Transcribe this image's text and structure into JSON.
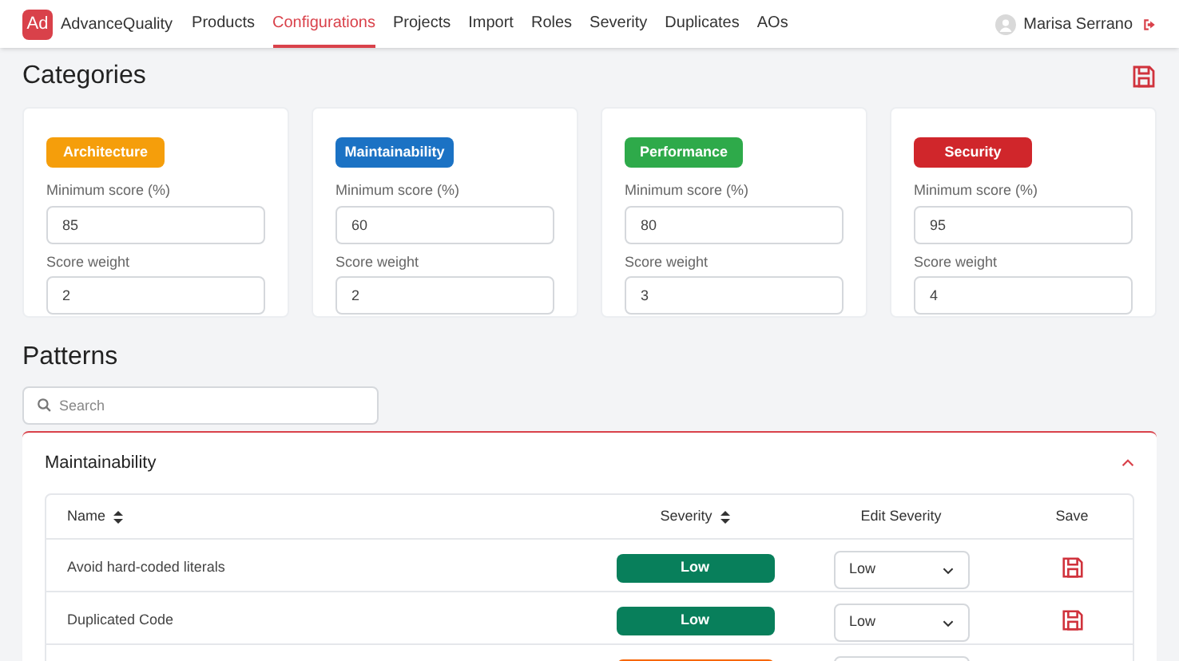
{
  "nav": {
    "logo": "Ad",
    "brand": "AdvanceQuality",
    "items": [
      {
        "label": "Products",
        "selected": false
      },
      {
        "label": "Configurations",
        "selected": true
      },
      {
        "label": "Projects",
        "selected": false
      },
      {
        "label": "Import",
        "selected": false
      },
      {
        "label": "Roles",
        "selected": false
      },
      {
        "label": "Severity",
        "selected": false
      },
      {
        "label": "Duplicates",
        "selected": false
      },
      {
        "label": "AOs",
        "selected": false
      }
    ],
    "user": "Marisa Serrano"
  },
  "categories": {
    "title": "Categories",
    "cards": [
      {
        "tag": "Architecture",
        "color": "#f59e0b",
        "min_label": "Minimum score (%)",
        "min_value": "85",
        "weight_label": "Score weight",
        "weight_value": "2"
      },
      {
        "tag": "Maintainability",
        "color": "#1b72c4",
        "min_label": "Minimum score (%)",
        "min_value": "60",
        "weight_label": "Score weight",
        "weight_value": "2"
      },
      {
        "tag": "Performance",
        "color": "#2eaa4a",
        "min_label": "Minimum score (%)",
        "min_value": "80",
        "weight_label": "Score weight",
        "weight_value": "3"
      },
      {
        "tag": "Security",
        "color": "#d0262b",
        "min_label": "Minimum score (%)",
        "min_value": "95",
        "weight_label": "Score weight",
        "weight_value": "4"
      }
    ]
  },
  "patterns": {
    "title": "Patterns",
    "search": {
      "placeholder": "Search"
    },
    "panel": {
      "title": "Maintainability",
      "expanded": true,
      "columns": [
        "Name",
        "Severity",
        "Edit Severity",
        "Save"
      ],
      "rows": [
        {
          "name": "Avoid hard-coded literals",
          "severity": "Low",
          "color": "#087f5b",
          "edit": "Low"
        },
        {
          "name": "Duplicated Code",
          "severity": "Low",
          "color": "#087f5b",
          "edit": "Low"
        },
        {
          "color": "#f76707"
        }
      ]
    }
  }
}
